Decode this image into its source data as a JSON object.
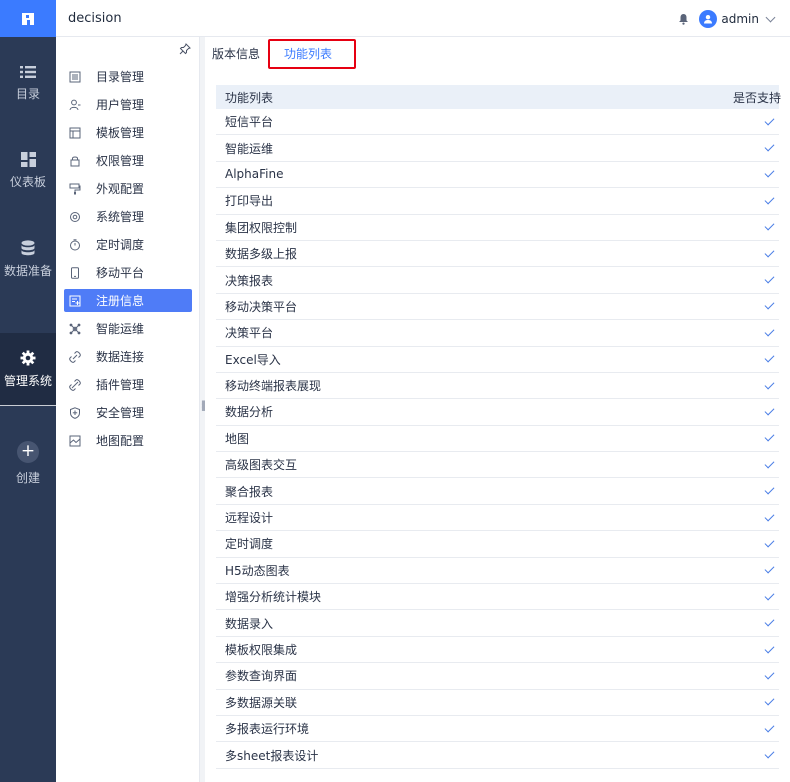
{
  "app": {
    "title": "decision"
  },
  "user": {
    "name": "admin"
  },
  "colors": {
    "brand": "#3b7bff",
    "nav_bg": "#2b3a56",
    "active_sub": "#4f7cf7",
    "highlight": "#e60012",
    "check": "#4a7ee6"
  },
  "leftnav": {
    "items": [
      {
        "label": "目录",
        "icon": "list-icon"
      },
      {
        "label": "仪表板",
        "icon": "dashboard-icon"
      },
      {
        "label": "数据准备",
        "icon": "database-icon"
      },
      {
        "label": "管理系统",
        "icon": "gear-icon"
      },
      {
        "label": "创建",
        "icon": "plus-icon"
      }
    ]
  },
  "subnav": {
    "items": [
      {
        "label": "目录管理",
        "icon": "catalog-icon"
      },
      {
        "label": "用户管理",
        "icon": "user-icon"
      },
      {
        "label": "模板管理",
        "icon": "template-icon"
      },
      {
        "label": "权限管理",
        "icon": "lock-icon"
      },
      {
        "label": "外观配置",
        "icon": "paint-roller-icon"
      },
      {
        "label": "系统管理",
        "icon": "settings-icon"
      },
      {
        "label": "定时调度",
        "icon": "timer-icon"
      },
      {
        "label": "移动平台",
        "icon": "mobile-icon"
      },
      {
        "label": "注册信息",
        "icon": "register-icon"
      },
      {
        "label": "智能运维",
        "icon": "ops-icon"
      },
      {
        "label": "数据连接",
        "icon": "link-icon"
      },
      {
        "label": "插件管理",
        "icon": "plugin-icon"
      },
      {
        "label": "安全管理",
        "icon": "shield-icon"
      },
      {
        "label": "地图配置",
        "icon": "map-icon"
      }
    ]
  },
  "tabs": [
    {
      "label": "版本信息"
    },
    {
      "label": "功能列表"
    }
  ],
  "table": {
    "headers": [
      "功能列表",
      "是否支持"
    ],
    "rows": [
      "短信平台",
      "智能运维",
      "AlphaFine",
      "打印导出",
      "集团权限控制",
      "数据多级上报",
      "决策报表",
      "移动决策平台",
      "决策平台",
      "Excel导入",
      "移动终端报表展现",
      "数据分析",
      "地图",
      "高级图表交互",
      "聚合报表",
      "远程设计",
      "定时调度",
      "H5动态图表",
      "增强分析统计模块",
      "数据录入",
      "模板权限集成",
      "参数查询界面",
      "多数据源关联",
      "多报表运行环境",
      "多sheet报表设计"
    ]
  }
}
